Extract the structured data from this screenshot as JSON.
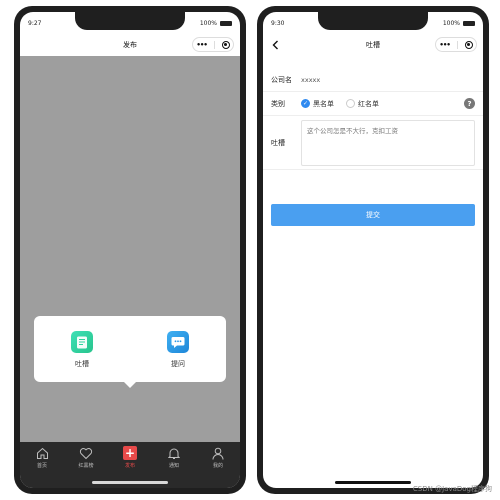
{
  "left_phone": {
    "status": {
      "time": "9:27",
      "battery": "100%"
    },
    "title": "发布",
    "popup": {
      "items": [
        {
          "label": "吐槽",
          "icon": "document-icon",
          "color": "#2fd39e"
        },
        {
          "label": "提问",
          "icon": "chat-icon",
          "color": "#2a97e6"
        }
      ]
    },
    "tabbar": {
      "items": [
        {
          "label": "首页",
          "icon": "home-icon"
        },
        {
          "label": "红黑榜",
          "icon": "heart-icon"
        },
        {
          "label": "发布",
          "icon": "plus-icon",
          "active": true
        },
        {
          "label": "通知",
          "icon": "bell-icon"
        },
        {
          "label": "我的",
          "icon": "user-icon"
        }
      ],
      "active_color": "#e84a4a"
    }
  },
  "right_phone": {
    "status": {
      "time": "9:30",
      "battery": "100%"
    },
    "title": "吐槽",
    "form": {
      "company_label": "公司名",
      "company_value": "xxxxx",
      "type_label": "类别",
      "type_options": [
        {
          "label": "黑名单",
          "checked": true
        },
        {
          "label": "红名单",
          "checked": false
        }
      ],
      "complain_label": "吐槽",
      "complain_placeholder": "这个公司怎是不大行，克扣工资"
    },
    "submit_label": "提交",
    "accent": "#4a9ff0"
  },
  "watermark": "CSDN @JavaDog程序狗"
}
